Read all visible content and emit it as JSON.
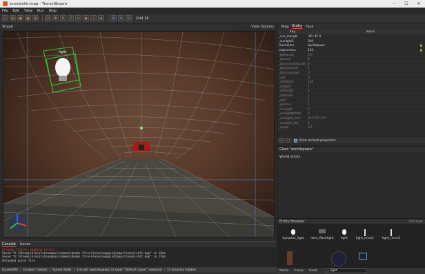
{
  "window": {
    "title": "tunnelshit.map - TrenchBroom",
    "controls": [
      "–",
      "☐",
      "✕"
    ]
  },
  "menu": [
    "File",
    "Edit",
    "View",
    "Run",
    "Help"
  ],
  "toolbar": {
    "grid_label": "Grid 16"
  },
  "viewport": {
    "left_label": "Shape",
    "right_label": "View Options",
    "entity_label": "light"
  },
  "bottom": {
    "tabs": [
      "Console",
      "Issues"
    ],
    "console_lines": [
      {
        "text": "Clipped texture mapping errors",
        "error": true
      },
      {
        "text": "Saved \"K:\\SteamLibrary\\steamapps\\common\\Quake 2\\rerelease\\mapping\\maps\\tunnelshit.map\" in 16ms",
        "error": false
      },
      {
        "text": "Saved \"K:\\SteamLibrary\\steamapps\\common\\Quake 2\\rerelease\\mapping\\maps\\tunnelshit.map\" in 25ms",
        "error": false
      },
      {
        "text": "Unloaded point file",
        "error": false
      }
    ]
  },
  "status": [
    "Quake2RE",
    "Quake2 (Valve)",
    "Tunnel Walls",
    "1 brush (worldspawn) in layer \"Default Layer\" selected",
    "11 brushes hidden"
  ],
  "inspector": {
    "tabs": [
      "Map",
      "Entity",
      "Face"
    ],
    "col_key": "Key",
    "col_value": "Value",
    "properties": [
      {
        "k": "_sun_mangle",
        "v": "-90 -45 0",
        "def": false,
        "lock": false
      },
      {
        "k": "_sunlight2",
        "v": "300",
        "def": false,
        "lock": false
      },
      {
        "k": "classname",
        "v": "worldspawn",
        "def": false,
        "lock": true
      },
      {
        "k": "mapversion",
        "v": "220",
        "def": false,
        "lock": true
      },
      {
        "k": "_lightscale",
        "v": "0.5",
        "def": true,
        "lock": false
      },
      {
        "k": "_bounce",
        "v": "0",
        "def": true,
        "lock": false
      },
      {
        "k": "_bouncecolorscale",
        "v": "0",
        "def": true,
        "lock": false
      },
      {
        "k": "_bouncescale",
        "v": "1",
        "def": true,
        "lock": false
      },
      {
        "k": "_bouncestyled",
        "v": "0",
        "def": true,
        "lock": false
      },
      {
        "k": "_dist",
        "v": "0",
        "def": true,
        "lock": false
      },
      {
        "k": "_dirtdepth",
        "v": "128",
        "def": true,
        "lock": false
      },
      {
        "k": "_dirtgain",
        "v": "1",
        "def": true,
        "lock": false
      },
      {
        "k": "_dirtmode",
        "v": "0",
        "def": true,
        "lock": false
      },
      {
        "k": "_dirtscale",
        "v": "1",
        "def": true,
        "lock": false
      },
      {
        "k": "_dist",
        "v": "1",
        "def": true,
        "lock": false
      },
      {
        "k": "_gamma",
        "v": "1",
        "def": true,
        "lock": false
      },
      {
        "k": "_minlight",
        "v": "0",
        "def": true,
        "lock": false
      },
      {
        "k": "_minlightMottle",
        "v": "0",
        "def": true,
        "lock": false
      },
      {
        "k": "_minlight_color",
        "v": "255 255 255",
        "def": true,
        "lock": false
      },
      {
        "k": "_minlight_dirt",
        "v": "0",
        "def": true,
        "lock": false
      },
      {
        "k": "_range",
        "v": "0.5",
        "def": true,
        "lock": false
      }
    ],
    "show_default": "Show default properties",
    "class_title": "Class \"worldspawn\"",
    "class_desc": "World entity"
  },
  "entity_browser": {
    "title": "Entity Browser",
    "settings": "Settings",
    "items": [
      "dynamic_light",
      "item_flashlight",
      "light",
      "light_mine1",
      "light_mine2"
    ],
    "sort_name": "Name",
    "sort_group": "Group",
    "sort_used": "Used",
    "search_value": "light"
  },
  "colors": {
    "accent": "#e0601c",
    "selection": "#2ecc40"
  }
}
